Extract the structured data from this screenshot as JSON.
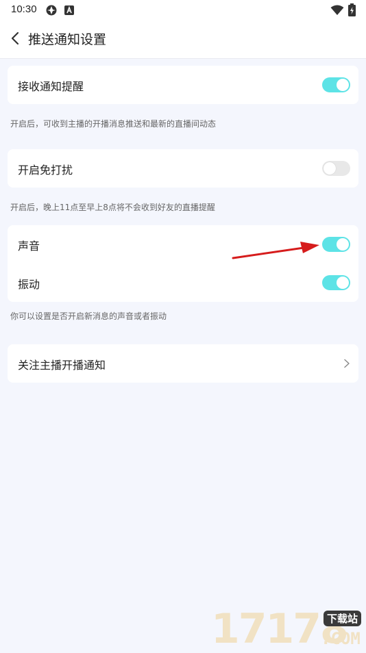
{
  "status_bar": {
    "time": "10:30"
  },
  "header": {
    "title": "推送通知设置"
  },
  "sections": {
    "receive": {
      "label": "接收通知提醒",
      "on": true,
      "hint": "开启后，可收到主播的开播消息推送和最新的直播间动态"
    },
    "dnd": {
      "label": "开启免打扰",
      "on": false,
      "hint": "开启后，晚上11点至早上8点将不会收到好友的直播提醒"
    },
    "sound": {
      "label": "声音",
      "on": true
    },
    "vibrate": {
      "label": "振动",
      "on": true,
      "hint": "你可以设置是否开启新消息的声音或者振动"
    },
    "follow": {
      "label": "关注主播开播通知"
    }
  },
  "watermark": {
    "number": "17178",
    "badge": "下载站",
    "domain": ".COM"
  },
  "colors": {
    "toggle_on": "#5de3e6",
    "toggle_off": "#e8e8e8",
    "background": "#f4f6fd",
    "annotation_arrow": "#d61c1c"
  }
}
